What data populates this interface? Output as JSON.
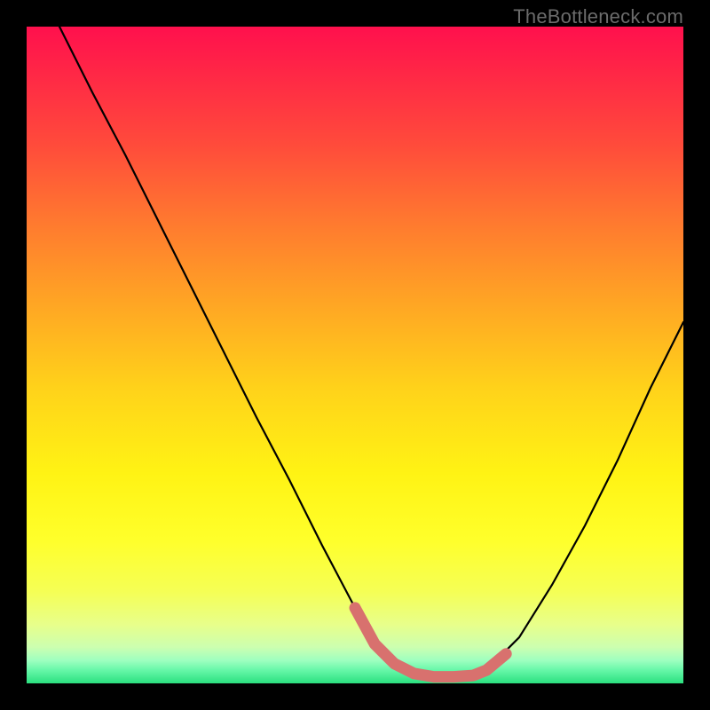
{
  "watermark": "TheBottleneck.com",
  "accent_colors": {
    "curve": "#000000",
    "emphasis": "#d8716e",
    "frame": "#000000"
  },
  "gradient_stops": [
    {
      "offset": 0.0,
      "color": "#ff104d"
    },
    {
      "offset": 0.08,
      "color": "#ff2a45"
    },
    {
      "offset": 0.18,
      "color": "#ff4b3b"
    },
    {
      "offset": 0.3,
      "color": "#ff7a2f"
    },
    {
      "offset": 0.42,
      "color": "#ffa524"
    },
    {
      "offset": 0.55,
      "color": "#ffd21a"
    },
    {
      "offset": 0.68,
      "color": "#fff314"
    },
    {
      "offset": 0.78,
      "color": "#ffff2a"
    },
    {
      "offset": 0.86,
      "color": "#f5ff55"
    },
    {
      "offset": 0.91,
      "color": "#e8ff8a"
    },
    {
      "offset": 0.945,
      "color": "#ccffb0"
    },
    {
      "offset": 0.965,
      "color": "#9effc0"
    },
    {
      "offset": 0.98,
      "color": "#66f7a8"
    },
    {
      "offset": 1.0,
      "color": "#2be07f"
    }
  ],
  "chart_data": {
    "type": "line",
    "title": "",
    "xlabel": "",
    "ylabel": "",
    "xlim": [
      0,
      100
    ],
    "ylim": [
      0,
      100
    ],
    "series": [
      {
        "name": "bottleneck-curve",
        "x": [
          5,
          10,
          15,
          20,
          25,
          30,
          35,
          40,
          45,
          50,
          53,
          56,
          59,
          62,
          65,
          68,
          70,
          75,
          80,
          85,
          90,
          95,
          100
        ],
        "values": [
          100,
          90,
          80.5,
          70.5,
          60.5,
          50.5,
          40.5,
          31,
          21,
          11.5,
          6,
          3,
          1.5,
          1,
          1,
          1.2,
          2,
          7,
          15,
          24,
          34,
          45,
          55
        ]
      }
    ],
    "emphasis_segment": {
      "note": "thick salmon overlay along the trough of the curve",
      "x": [
        50,
        53,
        56,
        59,
        62,
        65,
        68,
        70,
        73
      ],
      "values": [
        11.5,
        6,
        3,
        1.5,
        1,
        1,
        1.2,
        2,
        4.5
      ]
    }
  }
}
